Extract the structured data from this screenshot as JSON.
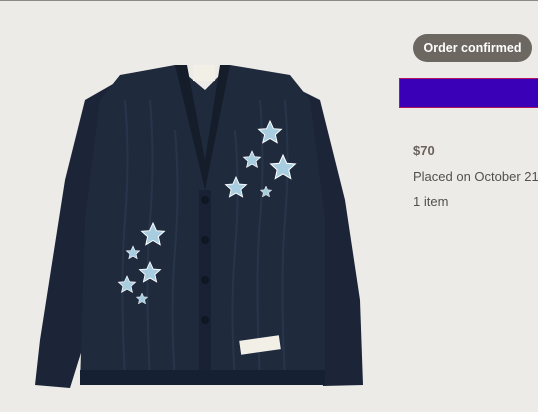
{
  "order": {
    "status_label": "Order confirmed",
    "price": "$70",
    "placed": "Placed on October 21,",
    "items": "1 item"
  },
  "product": {
    "image_kind": "navy cable-knit cardigan with light-blue star patches",
    "colors": {
      "body": "#1b2537",
      "stars": "#a9cde0",
      "label": "#f2efe6"
    }
  },
  "colors": {
    "background": "#ecebe8",
    "badge": "#6d6762",
    "banner": "#3a00b8",
    "banner_border": "#b0145a"
  }
}
